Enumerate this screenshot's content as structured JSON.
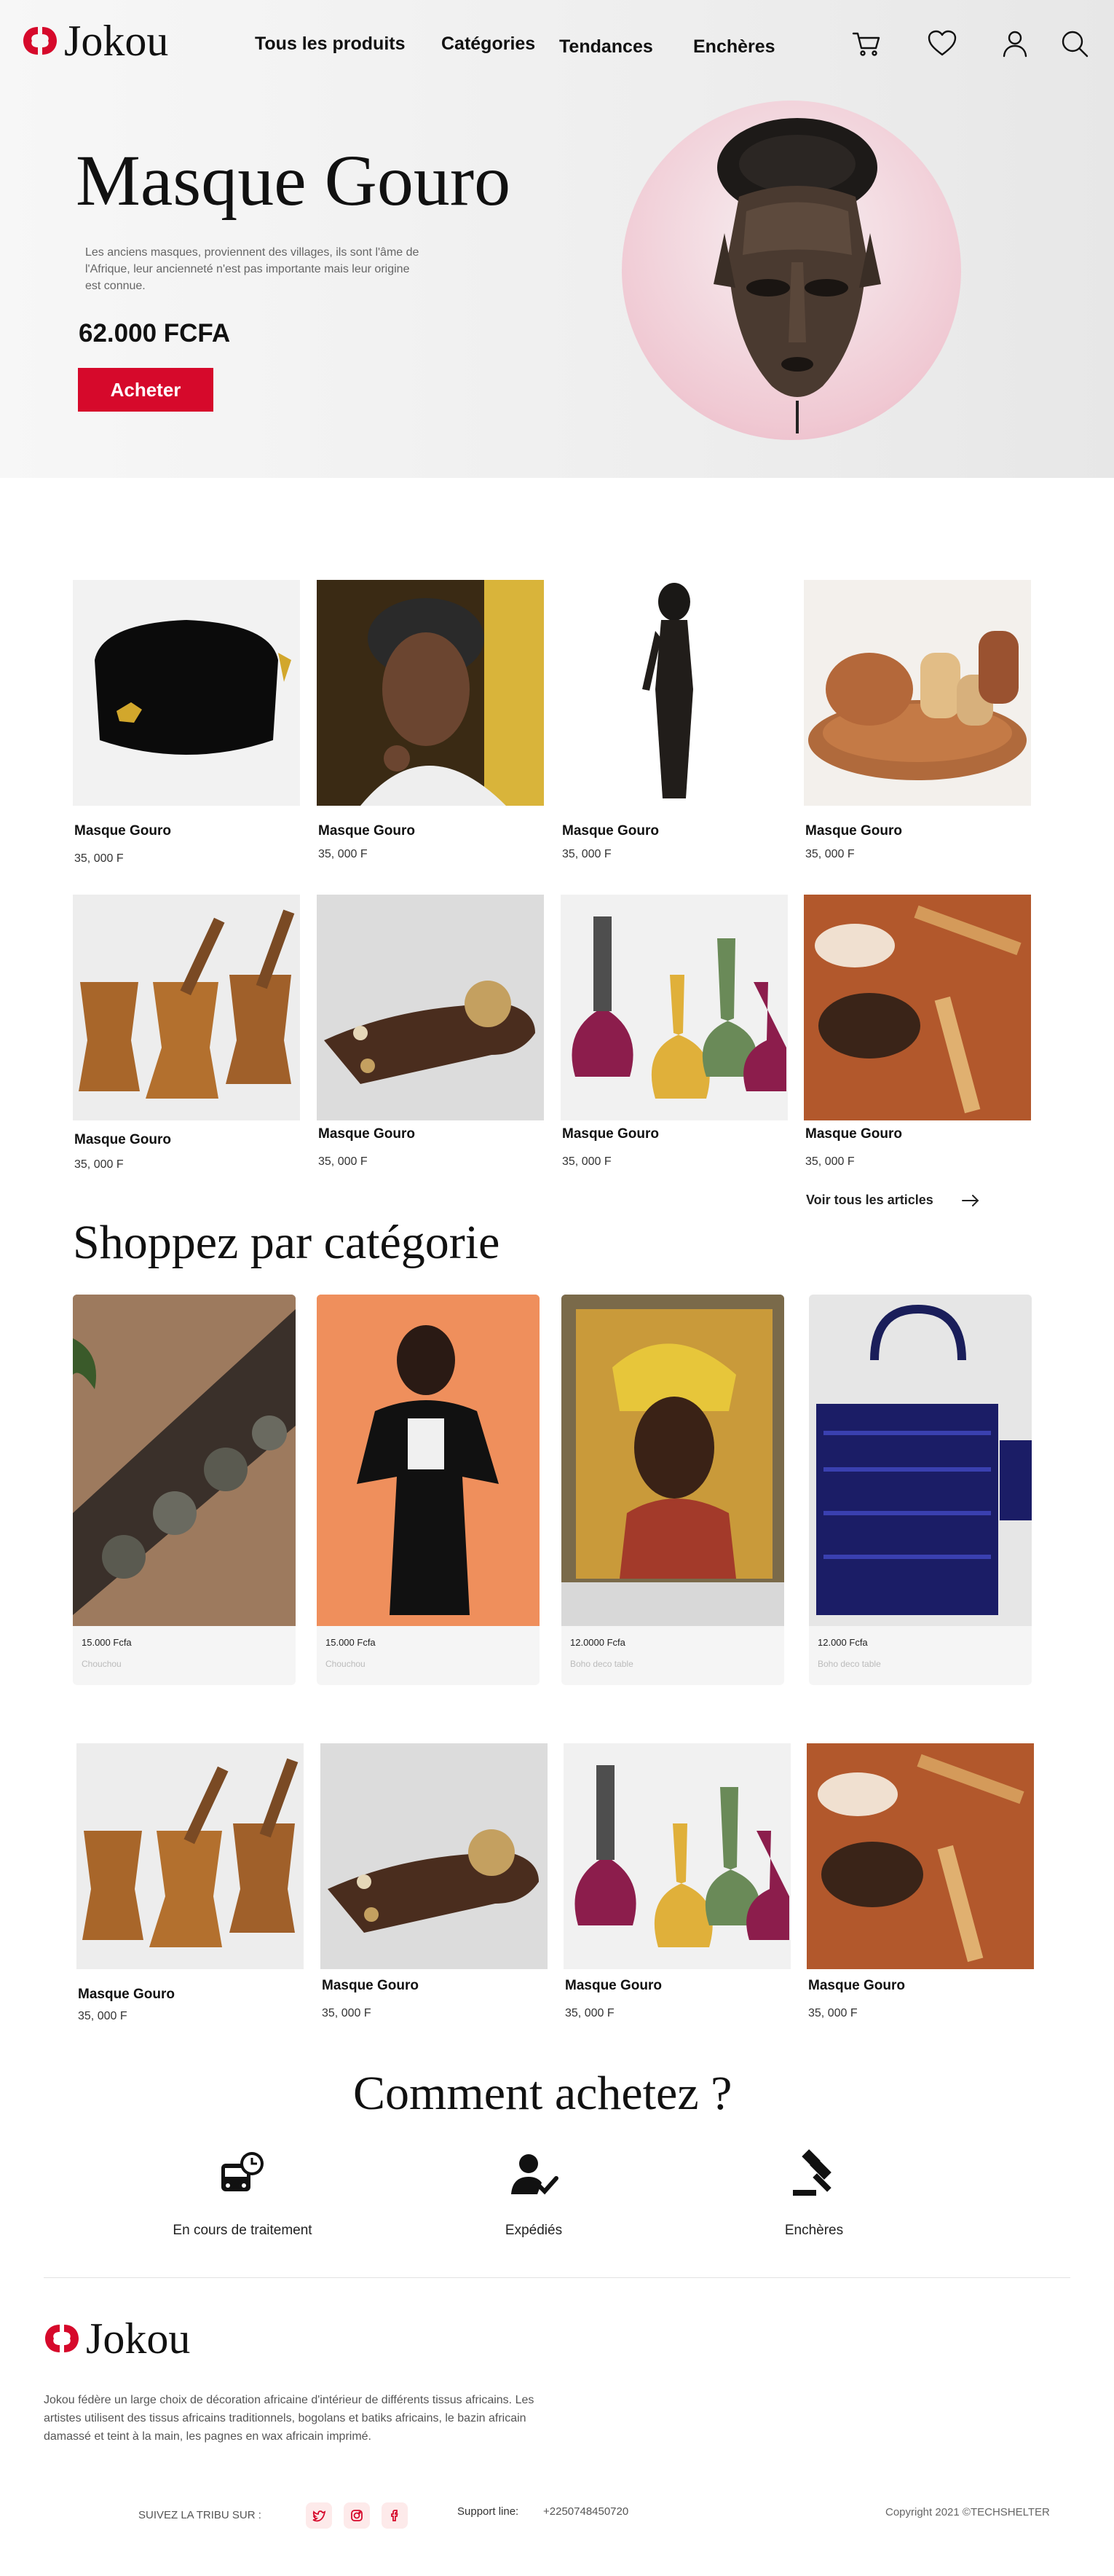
{
  "brand": {
    "name": "Jokou",
    "accent": "#d6092b"
  },
  "nav": {
    "links": [
      "Tous les produits",
      "Catégories",
      "Tendances",
      "Enchères"
    ],
    "icons": [
      "cart-icon",
      "heart-icon",
      "user-icon",
      "search-icon"
    ]
  },
  "hero": {
    "title": "Masque Gouro",
    "description": "Les anciens masques, proviennent des villages, ils sont l'âme de l'Afrique, leur ancienneté n'est pas importante mais leur origine est connue.",
    "price": "62.000 FCFA",
    "cta": "Acheter"
  },
  "products": [
    {
      "name": "Masque Gouro",
      "price": "35, 000 F",
      "image": "black-hat"
    },
    {
      "name": "Masque Gouro",
      "price": "35, 000 F",
      "image": "woman-headwrap"
    },
    {
      "name": "Masque Gouro",
      "price": "35, 000 F",
      "image": "wood-statue"
    },
    {
      "name": "Masque Gouro",
      "price": "35, 000 F",
      "image": "wood-pots"
    },
    {
      "name": "Masque Gouro",
      "price": "35, 000 F",
      "image": "mortars"
    },
    {
      "name": "Masque Gouro",
      "price": "35, 000 F",
      "image": "cowrie-ring"
    },
    {
      "name": "Masque Gouro",
      "price": "35, 000 F",
      "image": "vases"
    },
    {
      "name": "Masque Gouro",
      "price": "35, 000 F",
      "image": "spoons"
    }
  ],
  "see_all": "Voir tous les articles",
  "categories_section": {
    "title": "Shoppez par catégorie",
    "items": [
      {
        "price": "15.000 Fcfa",
        "label": "Chouchou"
      },
      {
        "price": "15.000 Fcfa",
        "label": "Chouchou"
      },
      {
        "price": "12.0000 Fcfa",
        "label": "Boho deco table"
      },
      {
        "price": "12.000 Fcfa",
        "label": "Boho deco table"
      }
    ]
  },
  "products_row3": [
    {
      "name": "Masque Gouro",
      "price": "35, 000 F"
    },
    {
      "name": "Masque Gouro",
      "price": "35, 000 F"
    },
    {
      "name": "Masque Gouro",
      "price": "35, 000 F"
    },
    {
      "name": "Masque Gouro",
      "price": "35, 000 F"
    }
  ],
  "how": {
    "title": "Comment achetez ?",
    "steps": [
      {
        "label": "En cours de traitement",
        "icon": "bus-clock-icon"
      },
      {
        "label": "Expédiés",
        "icon": "user-check-icon"
      },
      {
        "label": "Enchères",
        "icon": "gavel-icon"
      }
    ]
  },
  "footer": {
    "brand": "Jokou",
    "description": "Jokou fédère un large choix de décoration africaine d'intérieur de différents tissus africains. Les artistes utilisent des tissus africains traditionnels, bogolans et batiks africains, le bazin africain damassé et teint à la main, les pagnes en wax africain imprimé.",
    "follow": "SUIVEZ LA TRIBU SUR :",
    "social": [
      "twitter-icon",
      "instagram-icon",
      "facebook-icon"
    ],
    "support_label": "Support line:",
    "support_phone": "+2250748450720",
    "copyright": "Copyright  2021 ©TECHSHELTER"
  }
}
